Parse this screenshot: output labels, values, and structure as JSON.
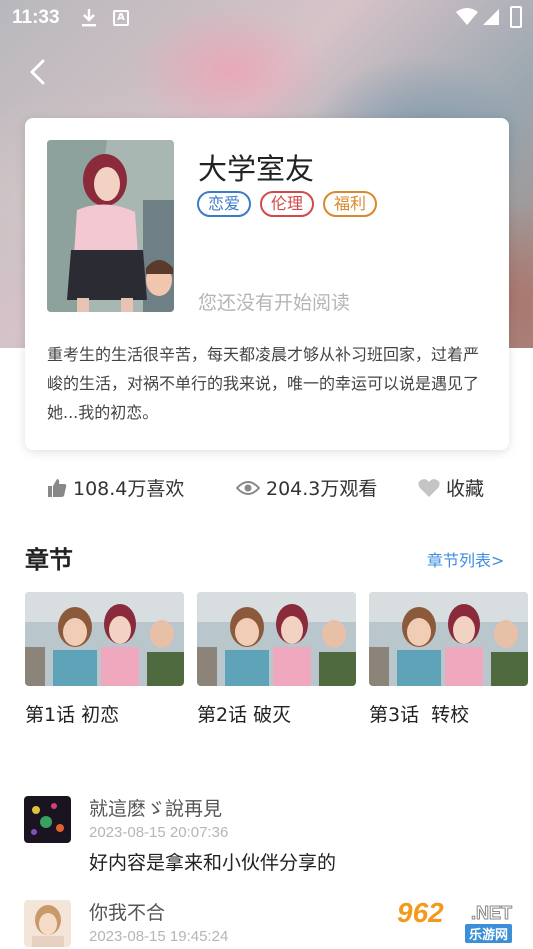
{
  "status_bar": {
    "time": "11:33",
    "a_badge": "A"
  },
  "book": {
    "title": "大学室友",
    "tags": [
      "恋爱",
      "伦理",
      "福利"
    ],
    "tag_colors": [
      "#3d7ac9",
      "#d04a4a",
      "#d9882b"
    ],
    "reading_status": "您还没有开始阅读",
    "description": "重考生的生活很辛苦，每天都凌晨才够从补习班回家，过着严峻的生活，对祸不单行的我来说，唯一的幸运可以说是遇见了她...我的初恋。"
  },
  "stats": {
    "likes": "108.4万喜欢",
    "views": "204.3万观看",
    "favorite": "收藏"
  },
  "chapters": {
    "section_title": "章节",
    "list_link": "章节列表>",
    "items": [
      {
        "label": "第1话 初恋"
      },
      {
        "label": "第2话 破灭"
      },
      {
        "label": "第3话  转校"
      }
    ]
  },
  "comments": [
    {
      "name": "就這麽ゞ說再見",
      "time": "2023-08-15 20:07:36",
      "text": "好内容是拿来和小伙伴分享的"
    },
    {
      "name": "你我不合",
      "time": "2023-08-15 19:45:24",
      "text": ""
    }
  ],
  "watermark": {
    "number": "962",
    "net": ".NET",
    "sub": "乐游网"
  },
  "colors": {
    "accent_link": "#3d8ee0",
    "muted_text": "#b5b5b5"
  }
}
